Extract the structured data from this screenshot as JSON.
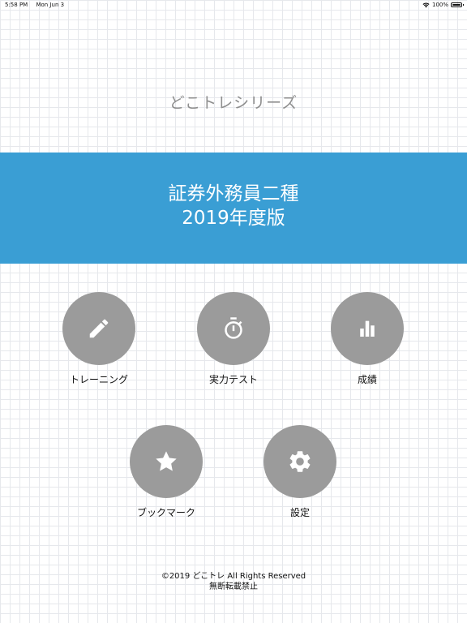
{
  "status_bar": {
    "time": "5:58 PM",
    "date": "Mon Jun 3",
    "battery": "100%",
    "icons": [
      "wifi-icon",
      "battery-icon"
    ]
  },
  "series_title": "どこトレシリーズ",
  "banner": {
    "line1": "証券外務員二種",
    "line2": "2019年度版",
    "color": "#3a9ed4"
  },
  "menu": {
    "training": {
      "label": "トレーニング",
      "icon": "pencil-icon"
    },
    "test": {
      "label": "実力テスト",
      "icon": "stopwatch-icon"
    },
    "results": {
      "label": "成績",
      "icon": "bar-chart-icon"
    },
    "bookmark": {
      "label": "ブックマーク",
      "icon": "star-icon"
    },
    "settings": {
      "label": "設定",
      "icon": "gear-icon"
    }
  },
  "footer": {
    "copyright": "©2019 どこトレ All Rights Reserved",
    "notice": "無断転載禁止"
  },
  "colors": {
    "button_fill": "#9b9b9b",
    "grid": "#e6e8ec"
  }
}
